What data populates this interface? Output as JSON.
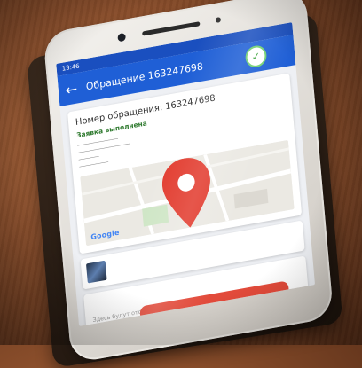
{
  "status_bar": {
    "time": "13:46"
  },
  "app_bar": {
    "title": "Обращение 163247698",
    "back_icon": "arrow-left-icon",
    "status_icon": "check-circle-icon"
  },
  "request": {
    "number_label": "Номер обращения: 163247698",
    "status": "Заявка выполнена"
  },
  "map": {
    "provider": "Google"
  },
  "comments": {
    "placeholder": "Здесь будут отображаться комментарии"
  },
  "colors": {
    "app_bar": "#1f5fd6",
    "status_ok": "#3aa33a",
    "action_button": "#e24a3a"
  }
}
